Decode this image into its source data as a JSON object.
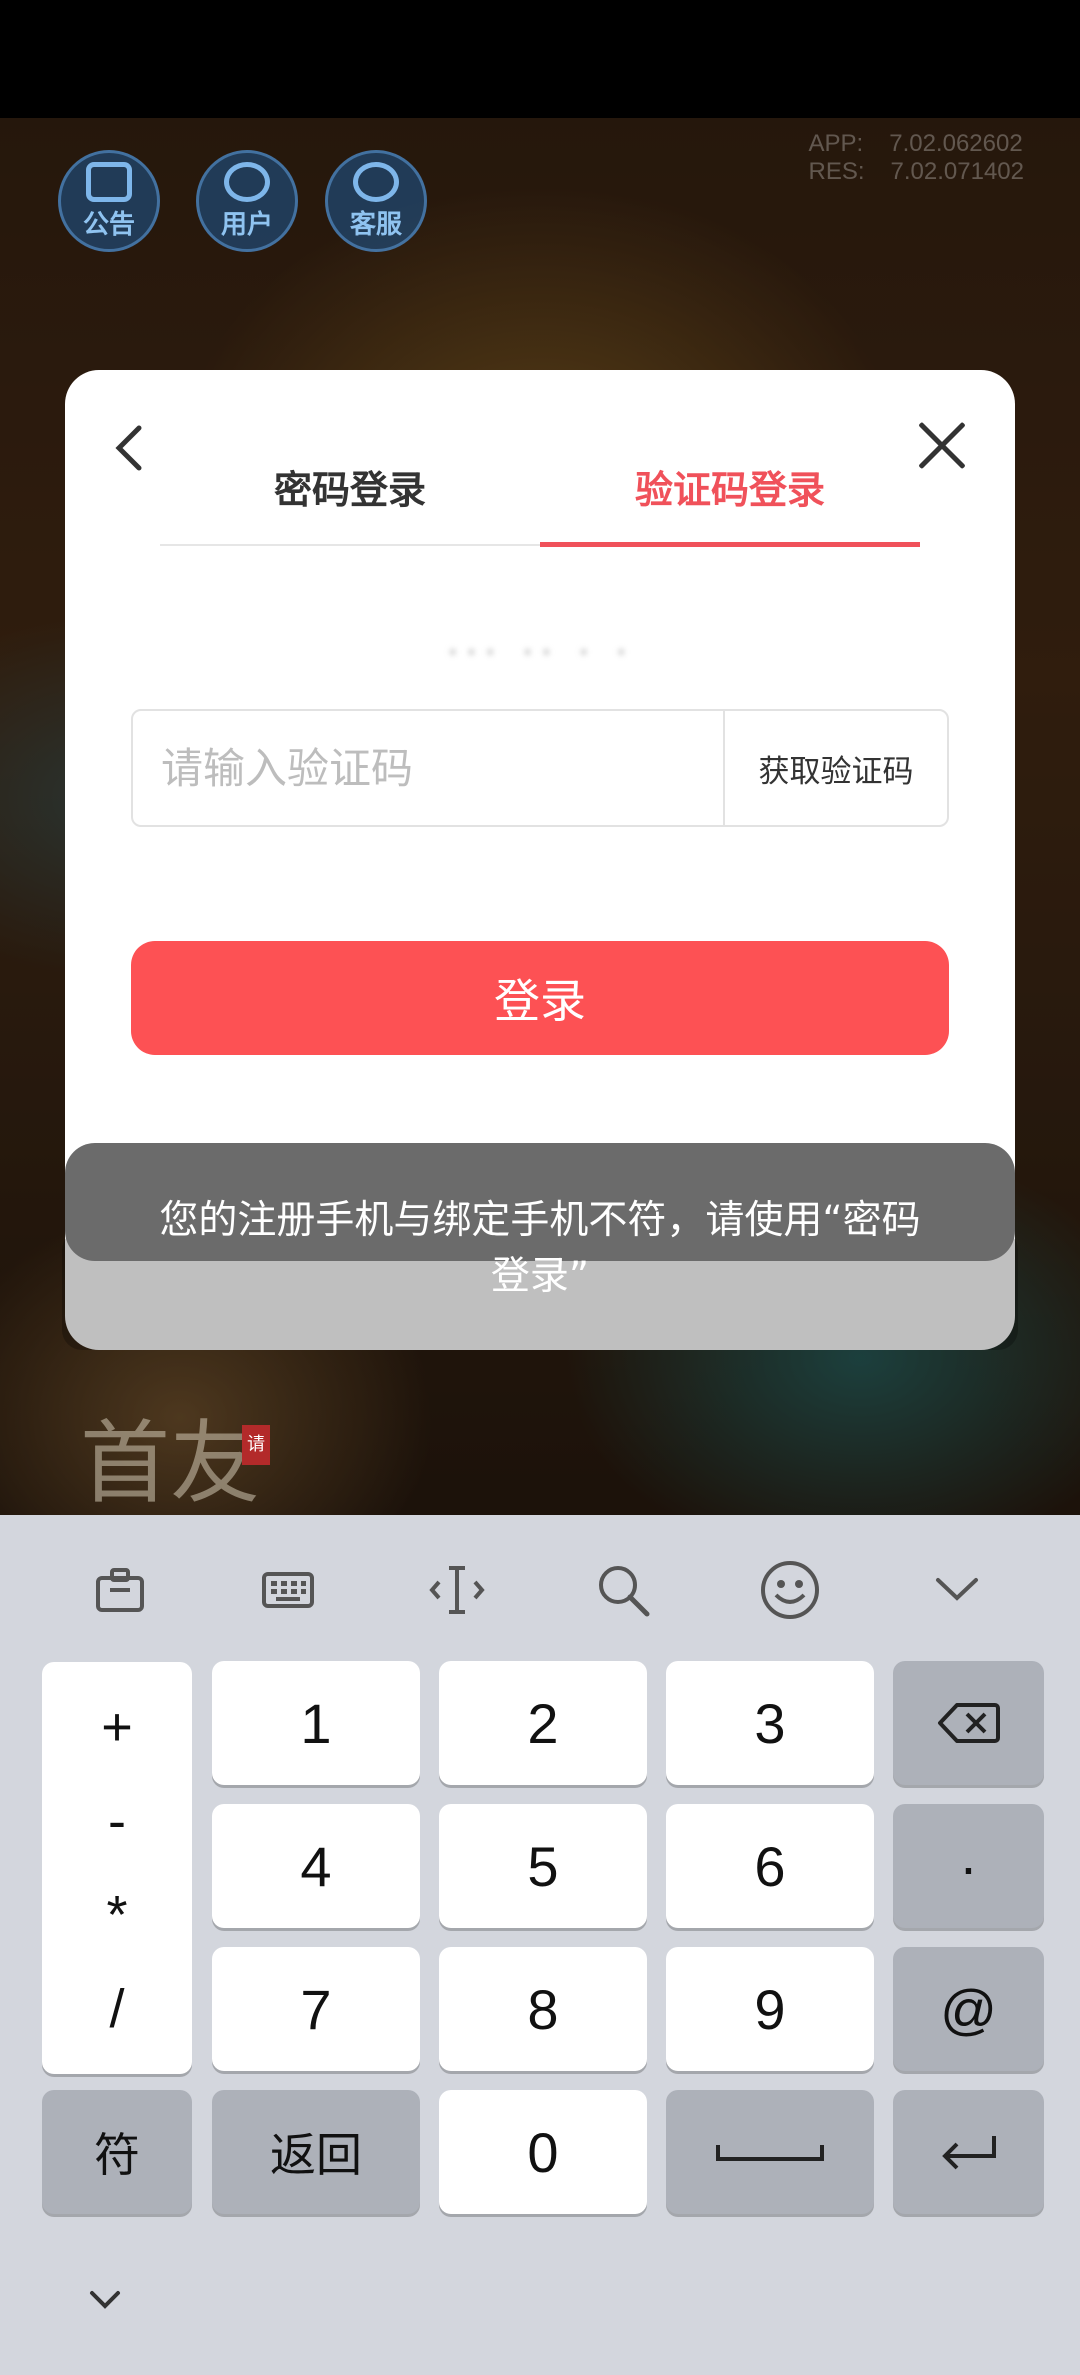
{
  "game": {
    "top_icons": [
      {
        "label": "公告",
        "icon": "notice-icon"
      },
      {
        "label": "用户",
        "icon": "user-icon"
      },
      {
        "label": "客服",
        "icon": "support-icon"
      }
    ],
    "version": {
      "app_label": "APP:",
      "app_value": "7.02.062602",
      "res_label": "RES:",
      "res_value": "7.02.071402"
    },
    "calligraphy": "首友",
    "seal": "请"
  },
  "dialog": {
    "tabs": [
      {
        "label": "密码登录",
        "active": false
      },
      {
        "label": "验证码登录",
        "active": true
      }
    ],
    "phone_masked": "··· ·· · ·",
    "code_placeholder": "请输入验证码",
    "get_code_label": "获取验证码",
    "login_label": "登录",
    "accent_color": "#fd5154"
  },
  "toast": {
    "line1": "您的注册手机与绑定手机不符，请使用“密码",
    "line2": "登录”"
  },
  "keyboard": {
    "toolbar": [
      "clipboard-icon",
      "keyboard-icon",
      "text-cursor-icon",
      "search-icon",
      "emoji-icon",
      "chevron-down-icon"
    ],
    "ops": [
      "+",
      "-",
      "*",
      "/"
    ],
    "digits": [
      "1",
      "2",
      "3",
      "4",
      "5",
      "6",
      "7",
      "8",
      "9",
      "0"
    ],
    "dot": "·",
    "at": "@",
    "symbols_label": "符",
    "back_label": "返回"
  }
}
